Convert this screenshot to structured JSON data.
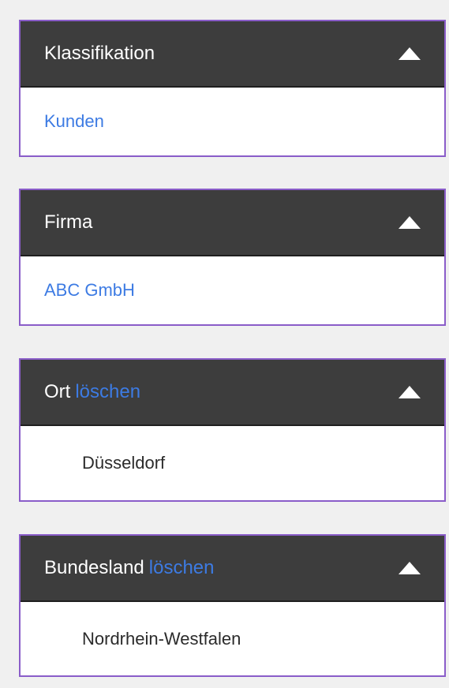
{
  "panels": [
    {
      "title": "Klassifikation",
      "delete_label": "",
      "value": "Kunden"
    },
    {
      "title": "Firma",
      "delete_label": "",
      "value": "ABC GmbH"
    },
    {
      "title": "Ort",
      "delete_label": "löschen",
      "value": "Düsseldorf"
    },
    {
      "title": "Bundesland",
      "delete_label": "löschen",
      "value": "Nordrhein-Westfalen"
    }
  ],
  "icons": {
    "collapse": "triangle-up-icon"
  },
  "colors": {
    "header_bg": "#3d3d3d",
    "panel_border": "#8a5dc9",
    "link": "#3d7be3",
    "page_bg": "#f0f0f0"
  }
}
